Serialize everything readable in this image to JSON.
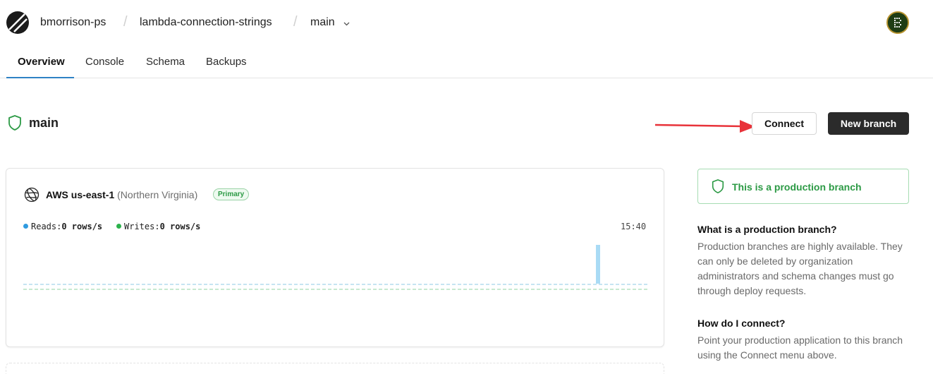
{
  "header": {
    "org": "bmorrison-ps",
    "database": "lambda-connection-strings",
    "branch": "main"
  },
  "tabs": [
    {
      "label": "Overview",
      "active": true
    },
    {
      "label": "Console",
      "active": false
    },
    {
      "label": "Schema",
      "active": false
    },
    {
      "label": "Backups",
      "active": false
    }
  ],
  "branch": {
    "name": "main",
    "connect_label": "Connect",
    "new_branch_label": "New branch"
  },
  "region_card": {
    "region": "AWS us-east-1",
    "region_detail": "(Northern Virginia)",
    "badge": "Primary",
    "reads_label": "Reads:",
    "reads_value": "0 rows/s",
    "writes_label": "Writes:",
    "writes_value": "0 rows/s",
    "time": "15:40"
  },
  "sidebar": {
    "production_notice": "This is a production branch",
    "q1": "What is a production branch?",
    "a1": "Production branches are highly available. They can only be deleted by organization administrators and schema changes must go through deploy requests.",
    "q2": "How do I connect?",
    "a2": "Point your production application to this branch using the Connect menu above."
  },
  "colors": {
    "accent_blue": "#2f82c5",
    "reads_dot": "#2f9be0",
    "writes_dot": "#2bb24c",
    "production_green": "#2c9a45",
    "arrow_red": "#e8333a",
    "primary_button": "#2b2b2b"
  },
  "icons": {
    "logo": "planetscale-logo",
    "chevron": "chevron-down-icon",
    "shield": "shield-icon",
    "globe": "globe-icon",
    "avatar": "avatar"
  }
}
